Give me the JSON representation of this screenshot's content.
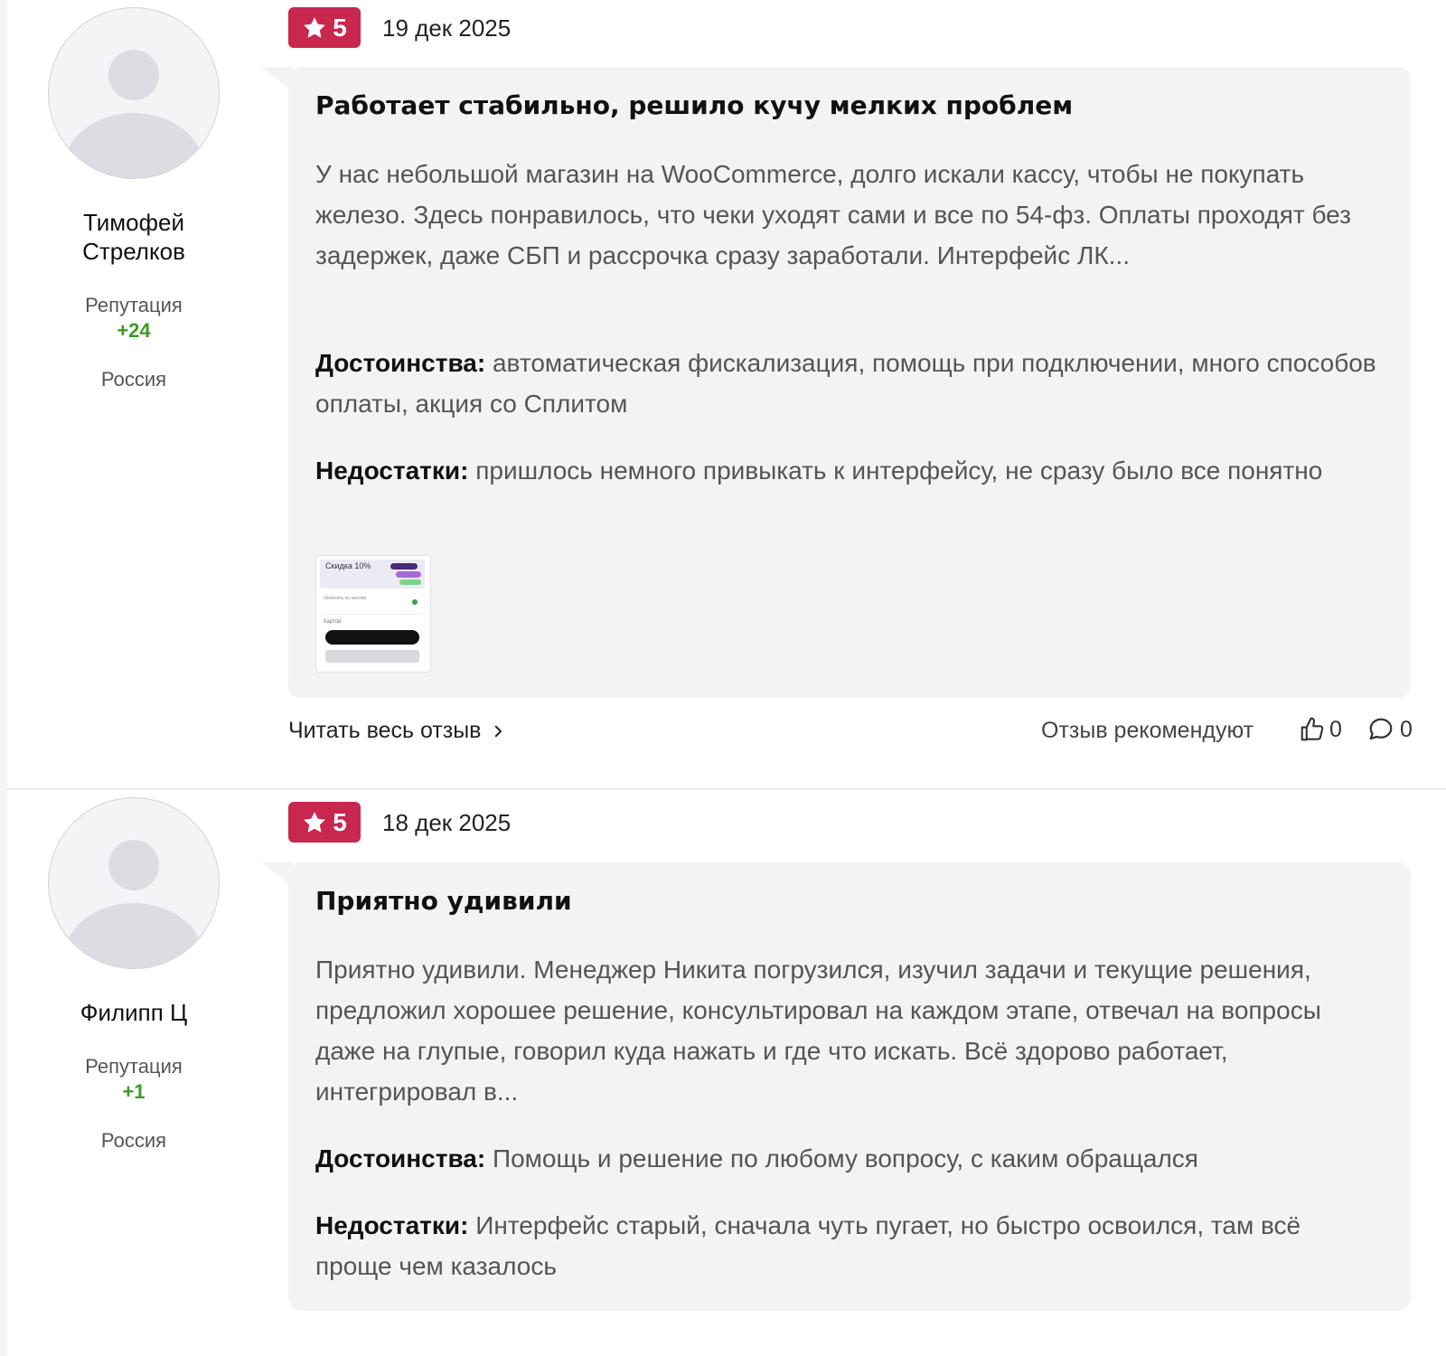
{
  "reviews": [
    {
      "author": {
        "name": "Тимофей Стрелков",
        "reputation_label": "Репутация",
        "reputation_value": "+24",
        "country": "Россия"
      },
      "rating": "5",
      "date": "19 дек 2025",
      "title": "Работает стабильно, решило кучу мелких проблем",
      "body": "У нас небольшой магазин на WooCommerce, долго искали кассу, чтобы не покупать железо. Здесь понравилось, что чеки уходят сами и все по 54-фз. Оплаты проходят без задержек, даже СБП и рассрочка сразу заработали. Интерфейс ЛК...",
      "pros_label": "Достоинства:",
      "pros": "автоматическая фискализация, помощь при подключении, много способов оплаты, акция со Сплитом",
      "cons_label": "Недостатки:",
      "cons": "пришлось немного привыкать к интерфейсу, не сразу было все понятно",
      "attachment": {
        "title": "Скидка 10%",
        "row_text": "Оплатить по частям",
        "label": "Картой"
      },
      "footer": {
        "read_more": "Читать весь отзыв",
        "recommend_label": "Отзыв рекомендуют",
        "likes": "0",
        "comments": "0"
      }
    },
    {
      "author": {
        "name": "Филипп Ц",
        "reputation_label": "Репутация",
        "reputation_value": "+1",
        "country": "Россия"
      },
      "rating": "5",
      "date": "18 дек 2025",
      "title": "Приятно удивили",
      "body": "Приятно удивили. Менеджер Никита погрузился, изучил задачи и текущие решения, предложил хорошее решение, консультировал на каждом этапе, отвечал на вопросы даже на глупые, говорил куда нажать и где что искать. Всё здорово работает, интегрировал в...",
      "pros_label": "Достоинства:",
      "pros": "Помощь и решение по любому вопросу, с каким обращался",
      "cons_label": "Недостатки:",
      "cons": "Интерфейс старый, сначала чуть пугает, но быстро освоился, там всё проще чем казалось"
    }
  ],
  "colors": {
    "rating_badge": "#c8274f",
    "reputation_positive": "#3c9a25",
    "bubble_bg": "#f3f3f5"
  },
  "icons": [
    "star-icon",
    "chevron-right-icon",
    "thumbs-up-icon",
    "comment-icon",
    "avatar-placeholder-icon"
  ]
}
